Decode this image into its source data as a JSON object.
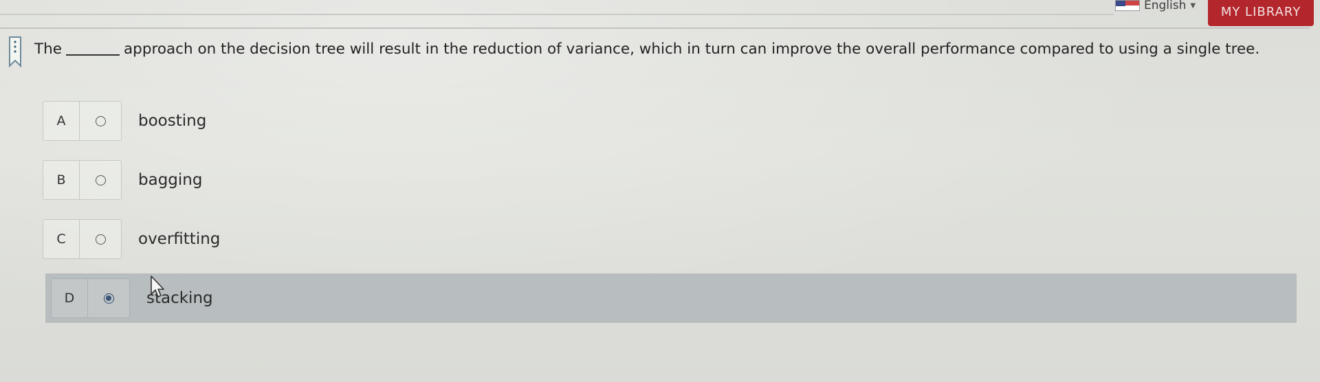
{
  "header": {
    "language": "English",
    "my_library": "MY LIBRARY"
  },
  "question": {
    "prefix": "The",
    "suffix": "approach on the decision tree will result in the reduction of variance, which in turn can improve the overall performance compared to using a single tree."
  },
  "options": [
    {
      "letter": "A",
      "label": "boosting",
      "selected": false
    },
    {
      "letter": "B",
      "label": "bagging",
      "selected": false
    },
    {
      "letter": "C",
      "label": "overfitting",
      "selected": false
    },
    {
      "letter": "D",
      "label": "stacking",
      "selected": true
    }
  ],
  "colors": {
    "accent": "#b3262b",
    "selected_row": "#b8bdbf",
    "radio_selected": "#3a5577"
  }
}
